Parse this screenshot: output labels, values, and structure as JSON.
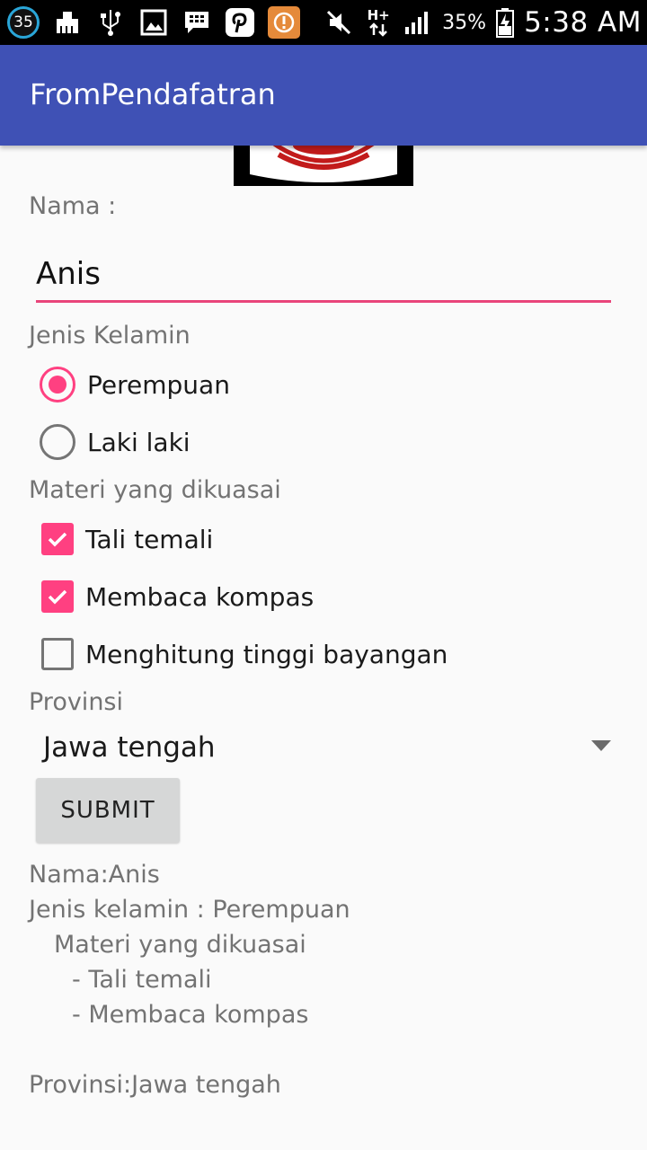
{
  "status_bar": {
    "notification_count": "35",
    "battery_percent": "35%",
    "time": "5:38 AM",
    "network": "H+",
    "icons": [
      "cleaner-icon",
      "usb-icon",
      "image-icon",
      "bbm-icon",
      "pinterest-icon",
      "alert-app-icon",
      "mute-icon",
      "data-icon",
      "signal-icon",
      "battery-charging-icon"
    ]
  },
  "app_bar": {
    "title": "FromPendafatran"
  },
  "form": {
    "nama_label": "Nama :",
    "nama_value": "Anis",
    "gender_label": "Jenis Kelamin",
    "gender_options": [
      {
        "label": "Perempuan",
        "checked": true
      },
      {
        "label": "Laki laki",
        "checked": false
      }
    ],
    "materi_label": "Materi yang dikuasai",
    "materi_options": [
      {
        "label": "Tali temali",
        "checked": true
      },
      {
        "label": "Membaca kompas",
        "checked": true
      },
      {
        "label": "Menghitung tinggi bayangan",
        "checked": false
      }
    ],
    "provinsi_label": "Provinsi",
    "provinsi_selected": "Jawa tengah",
    "submit_label": "SUBMIT"
  },
  "result": {
    "nama": "Nama:Anis",
    "jenis_kelamin": "Jenis kelamin : Perempuan",
    "materi_header": "Materi yang dikuasai",
    "materi_items": [
      "- Tali temali",
      "- Membaca kompas"
    ],
    "provinsi": "Provinsi:Jawa tengah"
  },
  "colors": {
    "primary": "#3f51b5",
    "accent": "#ff4081",
    "status_bar": "#000000",
    "background": "#fafafa"
  }
}
